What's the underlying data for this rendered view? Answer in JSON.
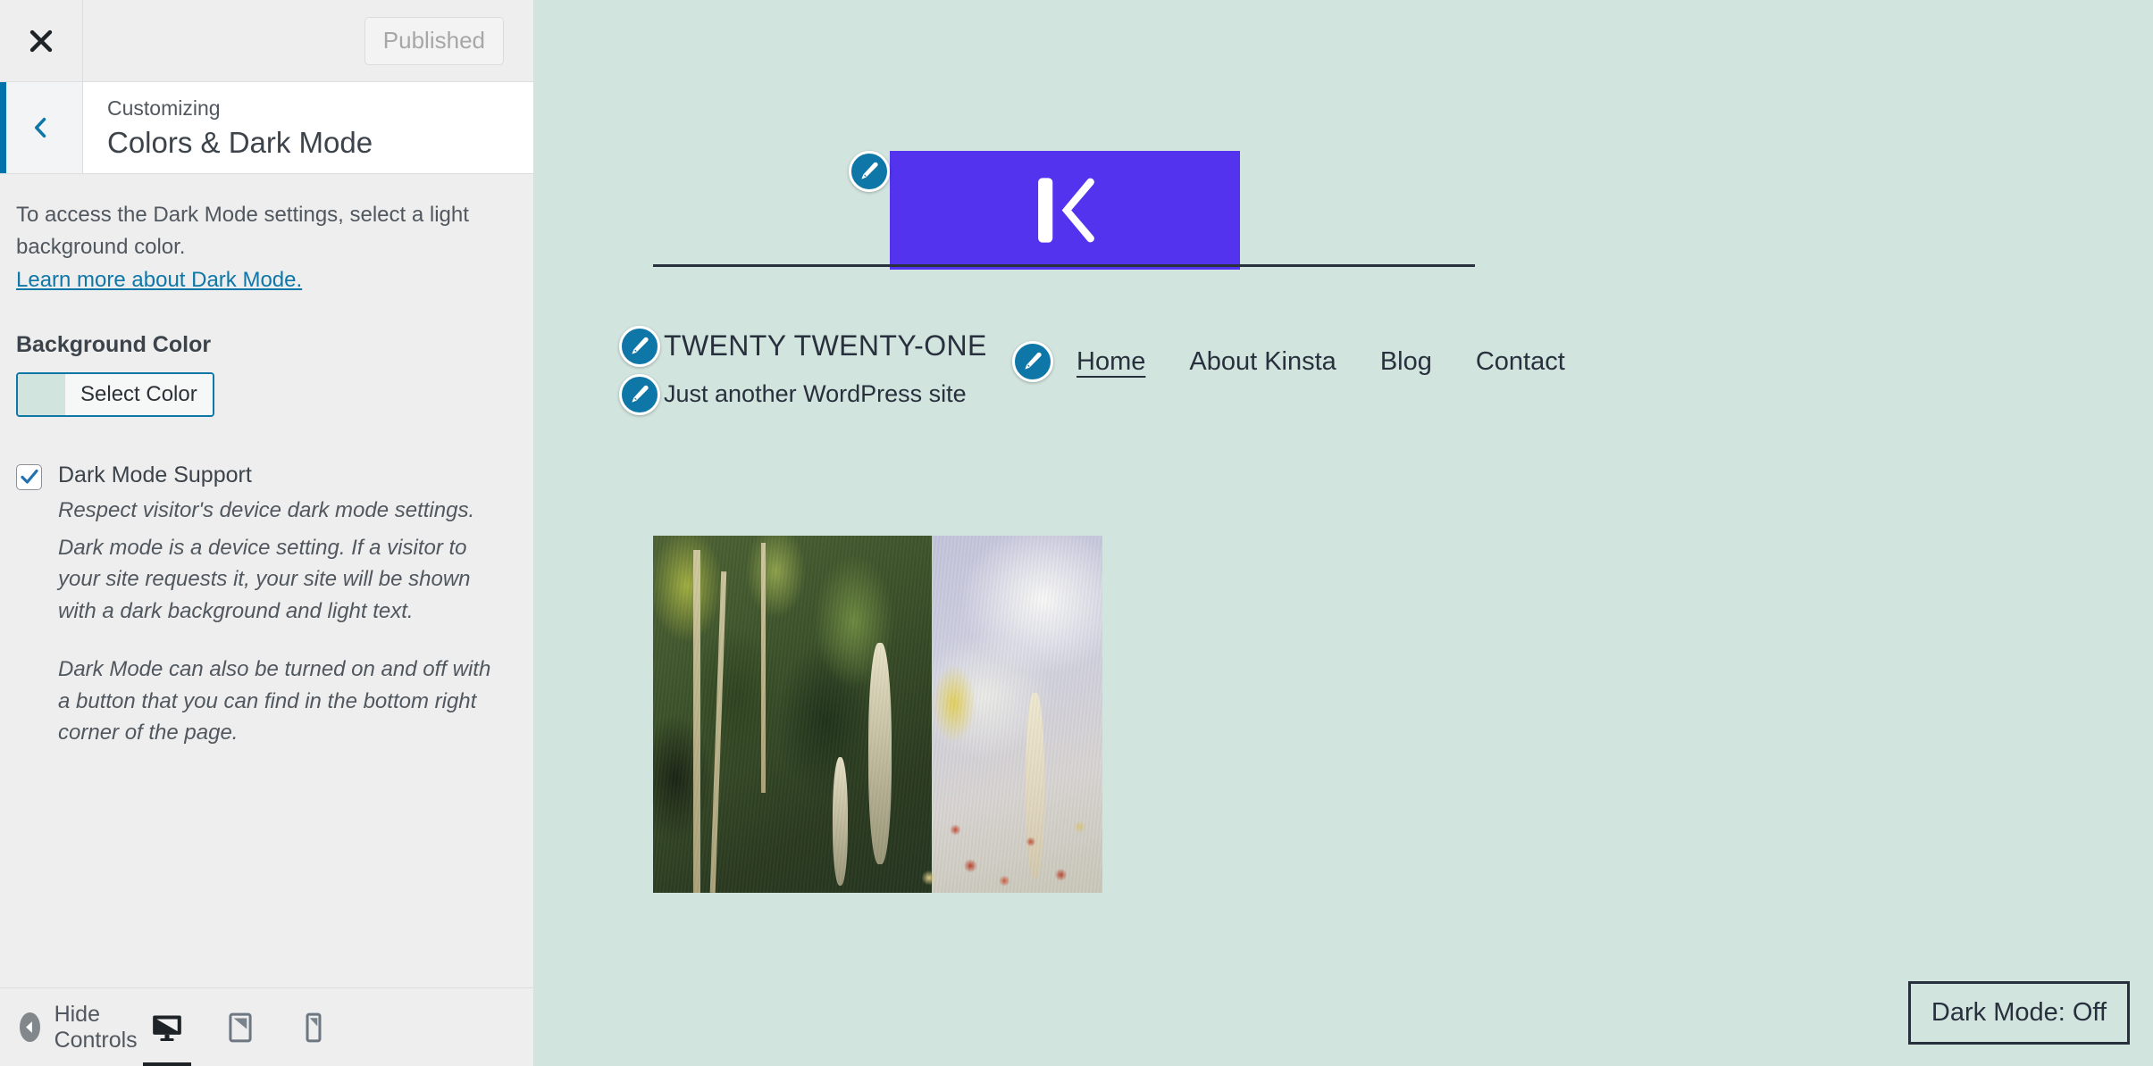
{
  "customizer": {
    "close_icon": "close-icon",
    "publish_button": "Published",
    "back_icon": "chevron-left-icon",
    "eyebrow": "Customizing",
    "panel_title": "Colors & Dark Mode",
    "description": "To access the Dark Mode settings, select a light background color.",
    "learn_more_link": "Learn more about Dark Mode.",
    "background_color": {
      "label": "Background Color",
      "button": "Select Color",
      "swatch_hex": "#d1e4dd"
    },
    "dark_mode_support": {
      "label": "Dark Mode Support",
      "checked": true,
      "description_1": "Respect visitor's device dark mode settings.",
      "description_2": "Dark mode is a device setting. If a visitor to your site requests it, your site will be shown with a dark background and light text.",
      "description_3": "Dark Mode can also be turned on and off with a button that you can find in the bottom right corner of the page."
    },
    "footer": {
      "hide_controls": "Hide Controls",
      "hide_icon": "arrow-left-circle-icon",
      "devices": [
        {
          "name": "desktop",
          "icon": "desktop-icon",
          "active": true
        },
        {
          "name": "tablet",
          "icon": "tablet-icon",
          "active": false
        },
        {
          "name": "mobile",
          "icon": "mobile-icon",
          "active": false
        }
      ]
    },
    "accent_color": "#0073aa"
  },
  "preview": {
    "background_hex": "#d1e4dd",
    "text_hex": "#28303d",
    "logo": {
      "alt": "Kinsta logo",
      "letter": "K",
      "background_hex": "#5333ed",
      "edit_icon": "pencil-edit-icon"
    },
    "site_title": "TWENTY TWENTY-ONE",
    "site_tagline": "Just another WordPress site",
    "nav": [
      {
        "label": "Home",
        "current": true
      },
      {
        "label": "About Kinsta",
        "current": false
      },
      {
        "label": "Blog",
        "current": false
      },
      {
        "label": "Contact",
        "current": false
      }
    ],
    "featured_image_alt": "Impressionist painting of a flowering garden with trees",
    "dark_mode_toggle": "Dark Mode: Off"
  }
}
